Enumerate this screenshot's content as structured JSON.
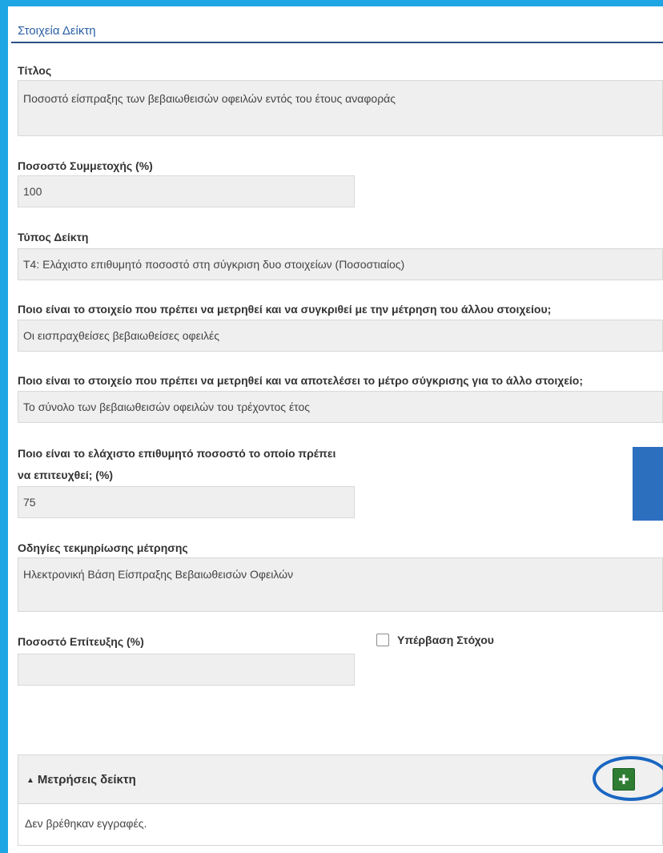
{
  "section": {
    "title": "Στοιχεία Δείκτη"
  },
  "fields": {
    "title": {
      "label": "Τίτλος",
      "value": "Ποσοστό είσπραξης των βεβαιωθεισών οφειλών εντός του έτους αναφοράς"
    },
    "participation": {
      "label": "Ποσοστό Συμμετοχής (%)",
      "value": "100"
    },
    "indicator_type": {
      "label": "Τύπος Δείκτη",
      "value": "Τ4: Ελάχιστο επιθυμητό ποσοστό στη σύγκριση δυο στοιχείων (Ποσοστιαίος)"
    },
    "measured_item": {
      "label": "Ποιο είναι το στοιχείο που πρέπει να μετρηθεί και να συγκριθεί με την μέτρηση του άλλου στοιχείου;",
      "value": "Οι εισπραχθείσες βεβαιωθείσες οφειλές"
    },
    "reference_item": {
      "label": "Ποιο είναι το στοιχείο που πρέπει να μετρηθεί και να αποτελέσει το μέτρο σύγκρισης για το άλλο στοιχείο;",
      "value": "Το σύνολο των βεβαιωθεισών οφειλών του τρέχοντος έτος"
    },
    "min_percentage": {
      "label_line1": "Ποιο είναι το ελάχιστο επιθυμητό ποσοστό το οποίο πρέπει",
      "label_line2": "να επιτευχθεί; (%)",
      "value": "75"
    },
    "documentation": {
      "label": "Οδηγίες τεκμηρίωσης μέτρησης",
      "value": "Ηλεκτρονική Βάση Είσπραξης Βεβαιωθεισών Οφειλών"
    },
    "achievement": {
      "label": "Ποσοστό Επίτευξης (%)",
      "value": ""
    },
    "exceed_target": {
      "label": "Υπέρβαση Στόχου",
      "checked": false
    }
  },
  "measurements": {
    "title": "Μετρήσεις δείκτη",
    "empty_text": "Δεν βρέθηκαν εγγραφές.",
    "add_icon": "plus-icon",
    "add_color": "#2e7d32"
  },
  "colors": {
    "frame": "#1ea5e4",
    "section_title": "#2b5fa6",
    "highlight": "#1a66c2"
  }
}
